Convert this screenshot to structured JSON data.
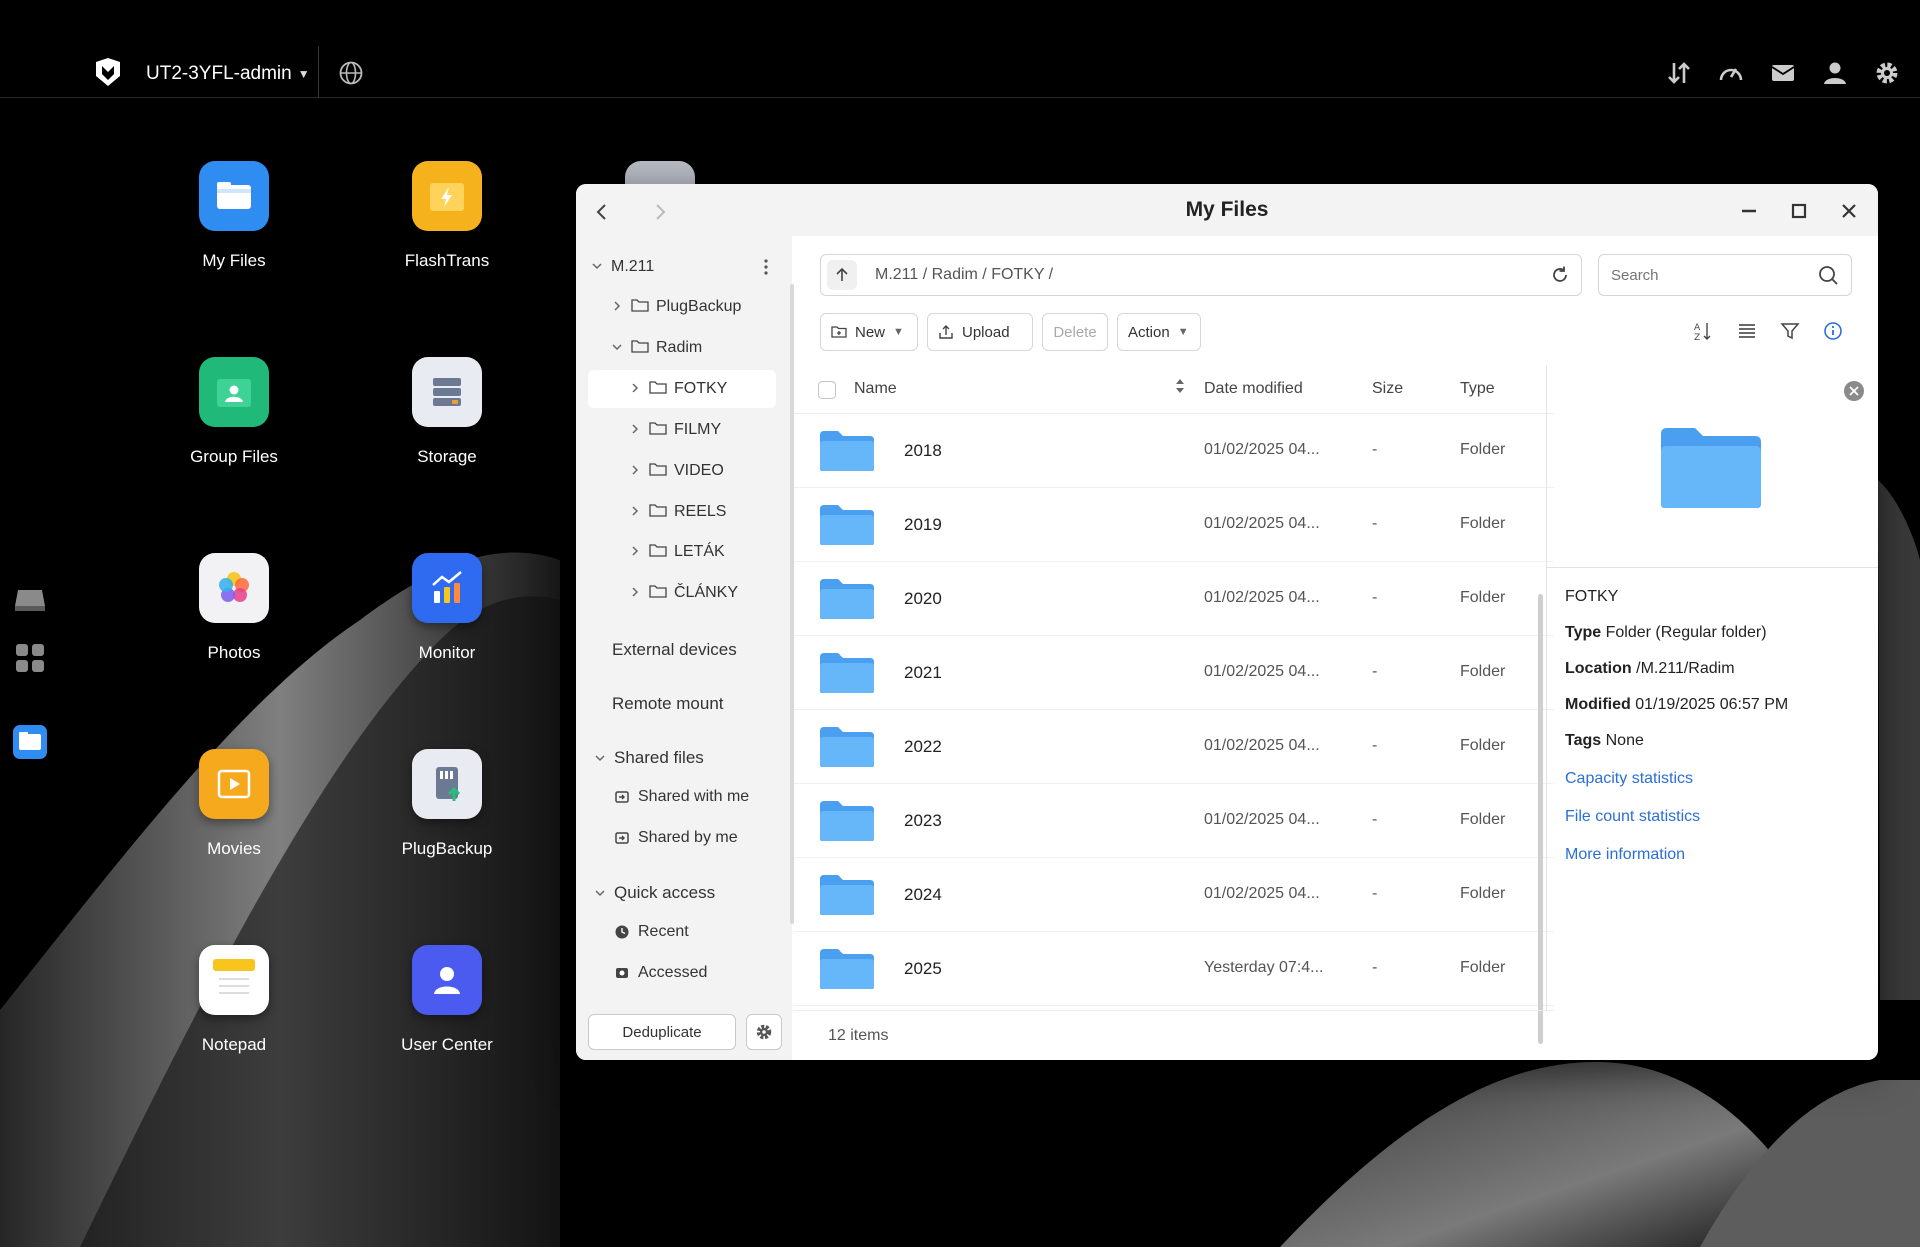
{
  "topbar": {
    "account": "UT2-3YFL-admin",
    "icons": [
      "transfer-icon",
      "speedometer-icon",
      "mail-icon",
      "user-icon",
      "gear-icon"
    ]
  },
  "desktop": {
    "apps": [
      {
        "label": "My Files",
        "icon": "folder-icon",
        "color": "#2f8cf0"
      },
      {
        "label": "FlashTrans",
        "icon": "flash-folder-icon",
        "color": "#f6b21c"
      },
      {
        "label": "Group Files",
        "icon": "group-folder-icon",
        "color": "#21b97a"
      },
      {
        "label": "Storage",
        "icon": "storage-icon",
        "color": "#e8ecf2"
      },
      {
        "label": "Photos",
        "icon": "photos-icon",
        "color": "#f2f2f4"
      },
      {
        "label": "Monitor",
        "icon": "monitor-icon",
        "color": "#2f6bf0"
      },
      {
        "label": "Movies",
        "icon": "movies-icon",
        "color": "#f7a91e"
      },
      {
        "label": "PlugBackup",
        "icon": "plugbackup-icon",
        "color": "#e8ecf2"
      },
      {
        "label": "Notepad",
        "icon": "notepad-icon",
        "color": "#ffffff"
      },
      {
        "label": "User Center",
        "icon": "user-center-icon",
        "color": "#4b5bf0"
      }
    ]
  },
  "window": {
    "title": "My Files",
    "sidebar": {
      "root": "M.211",
      "tree": [
        {
          "label": "PlugBackup"
        },
        {
          "label": "Radim"
        },
        {
          "label": "FOTKY"
        },
        {
          "label": "FILMY"
        },
        {
          "label": "VIDEO"
        },
        {
          "label": "REELS"
        },
        {
          "label": "LETÁK"
        },
        {
          "label": "ČLÁNKY"
        }
      ],
      "external": "External devices",
      "remote": "Remote mount",
      "shared_header": "Shared files",
      "shared_with": "Shared with me",
      "shared_by": "Shared by me",
      "quick_header": "Quick access",
      "recent": "Recent",
      "accessed": "Accessed",
      "dedup": "Deduplicate"
    },
    "path": "M.211 / Radim / FOTKY /",
    "search_placeholder": "Search",
    "toolbar": {
      "new": "New",
      "upload": "Upload",
      "delete": "Delete",
      "action": "Action"
    },
    "columns": {
      "name": "Name",
      "date": "Date modified",
      "size": "Size",
      "type": "Type"
    },
    "rows": [
      {
        "name": "2018",
        "date": "01/02/2025 04...",
        "size": "-",
        "type": "Folder"
      },
      {
        "name": "2019",
        "date": "01/02/2025 04...",
        "size": "-",
        "type": "Folder"
      },
      {
        "name": "2020",
        "date": "01/02/2025 04...",
        "size": "-",
        "type": "Folder"
      },
      {
        "name": "2021",
        "date": "01/02/2025 04...",
        "size": "-",
        "type": "Folder"
      },
      {
        "name": "2022",
        "date": "01/02/2025 04...",
        "size": "-",
        "type": "Folder"
      },
      {
        "name": "2023",
        "date": "01/02/2025 04...",
        "size": "-",
        "type": "Folder"
      },
      {
        "name": "2024",
        "date": "01/02/2025 04...",
        "size": "-",
        "type": "Folder"
      },
      {
        "name": "2025",
        "date": "Yesterday 07:4...",
        "size": "-",
        "type": "Folder"
      }
    ],
    "footer": "12 items",
    "details": {
      "name": "FOTKY",
      "type_label": "Type",
      "type_value": "Folder (Regular folder)",
      "location_label": "Location",
      "location_value": "/M.211/Radim",
      "modified_label": "Modified",
      "modified_value": "01/19/2025 06:57 PM",
      "tags_label": "Tags",
      "tags_value": "None",
      "capacity": "Capacity statistics",
      "filecount": "File count statistics",
      "more": "More information"
    }
  },
  "colors": {
    "accent": "#2b6fd6",
    "folder": "#5aaef7",
    "sidebar_bg": "#f3f3f4"
  }
}
